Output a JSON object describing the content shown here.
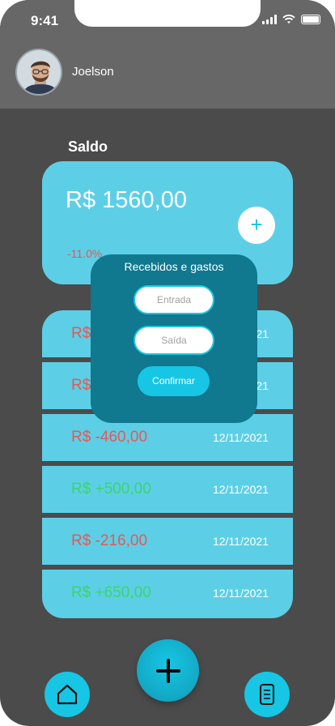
{
  "status_bar": {
    "time": "9:41"
  },
  "user": {
    "name": "Joelson"
  },
  "balance": {
    "label": "Saldo",
    "value": "R$ 1560,00",
    "change": "-11.0%",
    "add_symbol": "+"
  },
  "transactions": [
    {
      "amount": "R$",
      "date": "21",
      "type": "negative"
    },
    {
      "amount": "R$",
      "date": "21",
      "type": "negative"
    },
    {
      "amount": "R$ -460,00",
      "date": "12/11/2021",
      "type": "negative"
    },
    {
      "amount": "R$ +500,00",
      "date": "12/11/2021",
      "type": "positive"
    },
    {
      "amount": "R$ -216,00",
      "date": "12/11/2021",
      "type": "negative"
    },
    {
      "amount": "R$ +650,00",
      "date": "12/11/2021",
      "type": "positive"
    }
  ],
  "modal": {
    "title": "Recebidos e gastos",
    "entrada_placeholder": "Entrada",
    "saida_placeholder": "Saída",
    "confirm_label": "Confirmar"
  },
  "nav": {
    "home_icon": "home-icon",
    "add_icon": "plus-icon",
    "doc_icon": "document-icon"
  },
  "colors": {
    "accent": "#5ccfe6",
    "modal": "#10788f",
    "negative": "#e05a5a",
    "positive": "#3fd36b"
  }
}
